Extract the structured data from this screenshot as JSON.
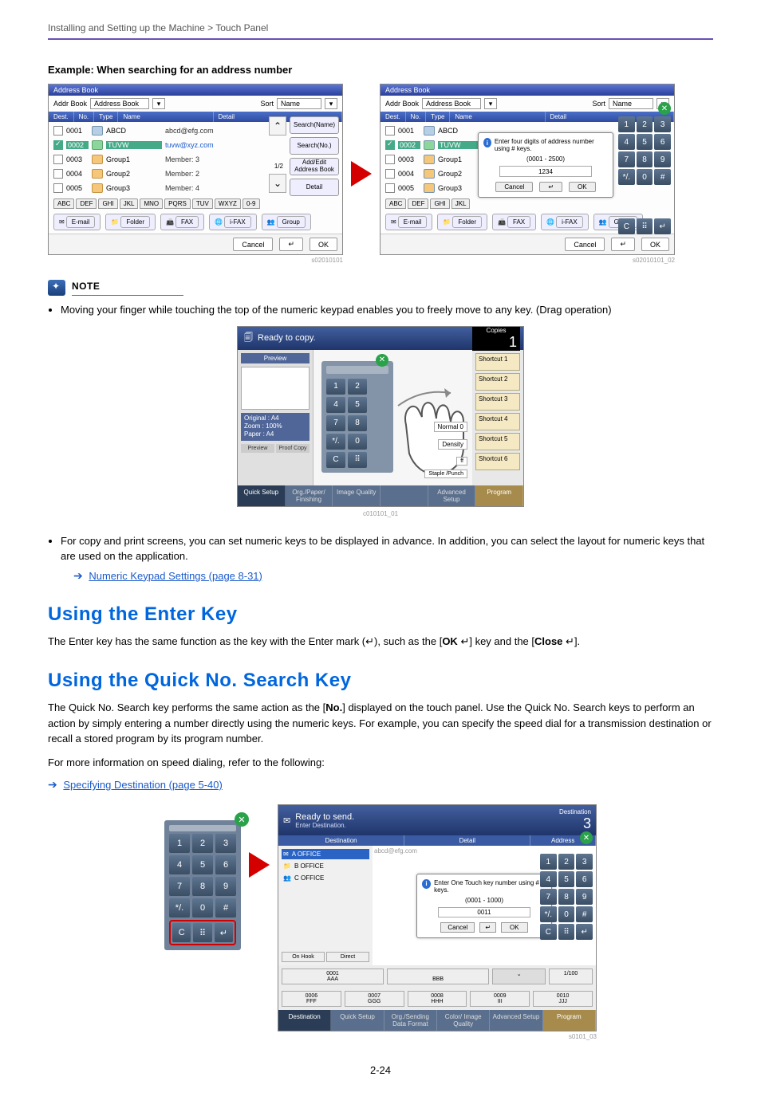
{
  "breadcrumb": "Installing and Setting up the Machine > Touch Panel",
  "example_heading": "Example: When searching for an address number",
  "addressbook": {
    "title": "Address Book",
    "addr_book_label": "Addr Book",
    "addr_book_value": "Address Book",
    "sort_label": "Sort",
    "sort_value": "Name",
    "headers": {
      "dest": "Dest.",
      "no": "No.",
      "type": "Type",
      "name": "Name",
      "detail": "Detail"
    },
    "rows": [
      {
        "no": "0001",
        "name": "ABCD",
        "detail": "abcd@efg.com",
        "selected": false
      },
      {
        "no": "0002",
        "name": "TUVW",
        "detail": "tuvw@xyz.com",
        "selected": true
      },
      {
        "no": "0003",
        "name": "Group1",
        "detail": "Member:    3",
        "selected": false
      },
      {
        "no": "0004",
        "name": "Group2",
        "detail": "Member:    2",
        "selected": false
      },
      {
        "no": "0005",
        "name": "Group3",
        "detail": "Member:    4",
        "selected": false
      }
    ],
    "alphatabs": [
      "ABC",
      "DEF",
      "GHI",
      "JKL",
      "MNO",
      "PQRS",
      "TUV",
      "WXYZ",
      "0-9"
    ],
    "bottom_buttons": {
      "email": "E-mail",
      "folder": "Folder",
      "fax": "FAX",
      "ifax": "i-FAX",
      "group": "Group"
    },
    "side_buttons": {
      "search_name": "Search(Name)",
      "search_no": "Search(No.)",
      "add_edit": "Add/Edit Address Book",
      "detail_btn": "Detail"
    },
    "page": "1/2",
    "cancel": "Cancel",
    "ok": "OK",
    "fig_id_left": "s02010101"
  },
  "numpad_keys": [
    "1",
    "2",
    "3",
    "4",
    "5",
    "6",
    "7",
    "8",
    "9",
    "*/.",
    "0",
    "#"
  ],
  "numpad_row2": [
    "C",
    "⠿",
    "↵"
  ],
  "popup_addr": {
    "hint": "Enter four digits of address number using # keys.",
    "range": "(0001 - 2500)",
    "value": "1234",
    "cancel": "Cancel",
    "ok": "OK",
    "fig_id": "s02010101_02"
  },
  "note_label": "NOTE",
  "note_bullets": [
    "Moving your finger while touching the top of the numeric keypad enables you to freely move to any key. (Drag operation)"
  ],
  "copy_panel": {
    "title": "Ready to copy.",
    "copies_label": "Copies",
    "copies_value": "1",
    "preview": "Preview",
    "original": "Original",
    "zoom": "Zoom",
    "paper": "Paper",
    "a4": "A4",
    "zoom_val": "100%",
    "preview_btn": "Preview",
    "proof_btn": "Proof Copy",
    "normal_tag": "Normal 0",
    "density_tag": "Density",
    "staple_tag": "Staple /Punch",
    "off_tag": "ff",
    "shortcuts": [
      "Shortcut 1",
      "Shortcut 2",
      "Shortcut 3",
      "Shortcut 4",
      "Shortcut 5",
      "Shortcut 6"
    ],
    "tabs": [
      "Quick Setup",
      "Org./Paper/ Finishing",
      "Image Quality",
      "",
      "Advanced Setup",
      "Program"
    ],
    "fig_id": "c010101_01"
  },
  "bullets_after_copy": [
    "For copy and print screens, you can set numeric keys to be displayed in advance. In addition, you can select the layout for numeric keys that are used on the application."
  ],
  "link_numeric": "Numeric Keypad Settings (page 8-31)",
  "h2_enter": "Using the Enter Key",
  "enter_para_a": "The Enter key has the same function as the key with the Enter mark (",
  "enter_para_b": "), such as the [",
  "enter_ok": "OK ",
  "enter_para_c": "] key and the [",
  "enter_close": "Close ",
  "enter_para_d": "].",
  "h2_quick": "Using the Quick No. Search Key",
  "quick_para1": "The Quick No. Search key performs the same action as the [No.] displayed on the touch panel. Use the Quick No. Search keys to perform an action by simply entering a number directly using the numeric keys. For example, you can specify the speed dial for a transmission destination or recall a stored program by its program number.",
  "quick_no_strong": "No.",
  "quick_para2": "For more information on speed dialing, refer to the following:",
  "link_specdest": "Specifying Destination (page 5-40)",
  "send_panel": {
    "title": "Ready to send.",
    "subtitle": "Enter Destination.",
    "dest_label": "Destination",
    "dest_value": "3",
    "hdr_dest": "Destination",
    "hdr_detail": "Detail",
    "addr_hint": "Address",
    "offices": [
      "A OFFICE",
      "B OFFICE",
      "C OFFICE"
    ],
    "detail_text": "abcd@efg.com",
    "onhook": "On Hook",
    "direct": "Direct",
    "chain": "",
    "popup_hint": "Enter One Touch key number using # keys.",
    "popup_range": "(0001 - 1000)",
    "popup_value": "0011",
    "cancel": "Cancel",
    "ok": "OK",
    "bottom_keys": [
      {
        "no": "0001",
        "lbl": "AAA"
      },
      {
        "no": "",
        "lbl": "BBB"
      },
      {
        "no": "0006",
        "lbl": "FFF"
      },
      {
        "no": "0007",
        "lbl": "GGG"
      },
      {
        "no": "0008",
        "lbl": "HHH"
      },
      {
        "no": "0009",
        "lbl": "III"
      },
      {
        "no": "0010",
        "lbl": "JJJ"
      }
    ],
    "page": "1/100",
    "tabs": [
      "Destination",
      "Quick Setup",
      "Org./Sending Data Format",
      "Color/ Image Quality",
      "Advanced Setup",
      "Program"
    ],
    "fig_id": "s0101_03"
  },
  "footer": "2-24"
}
